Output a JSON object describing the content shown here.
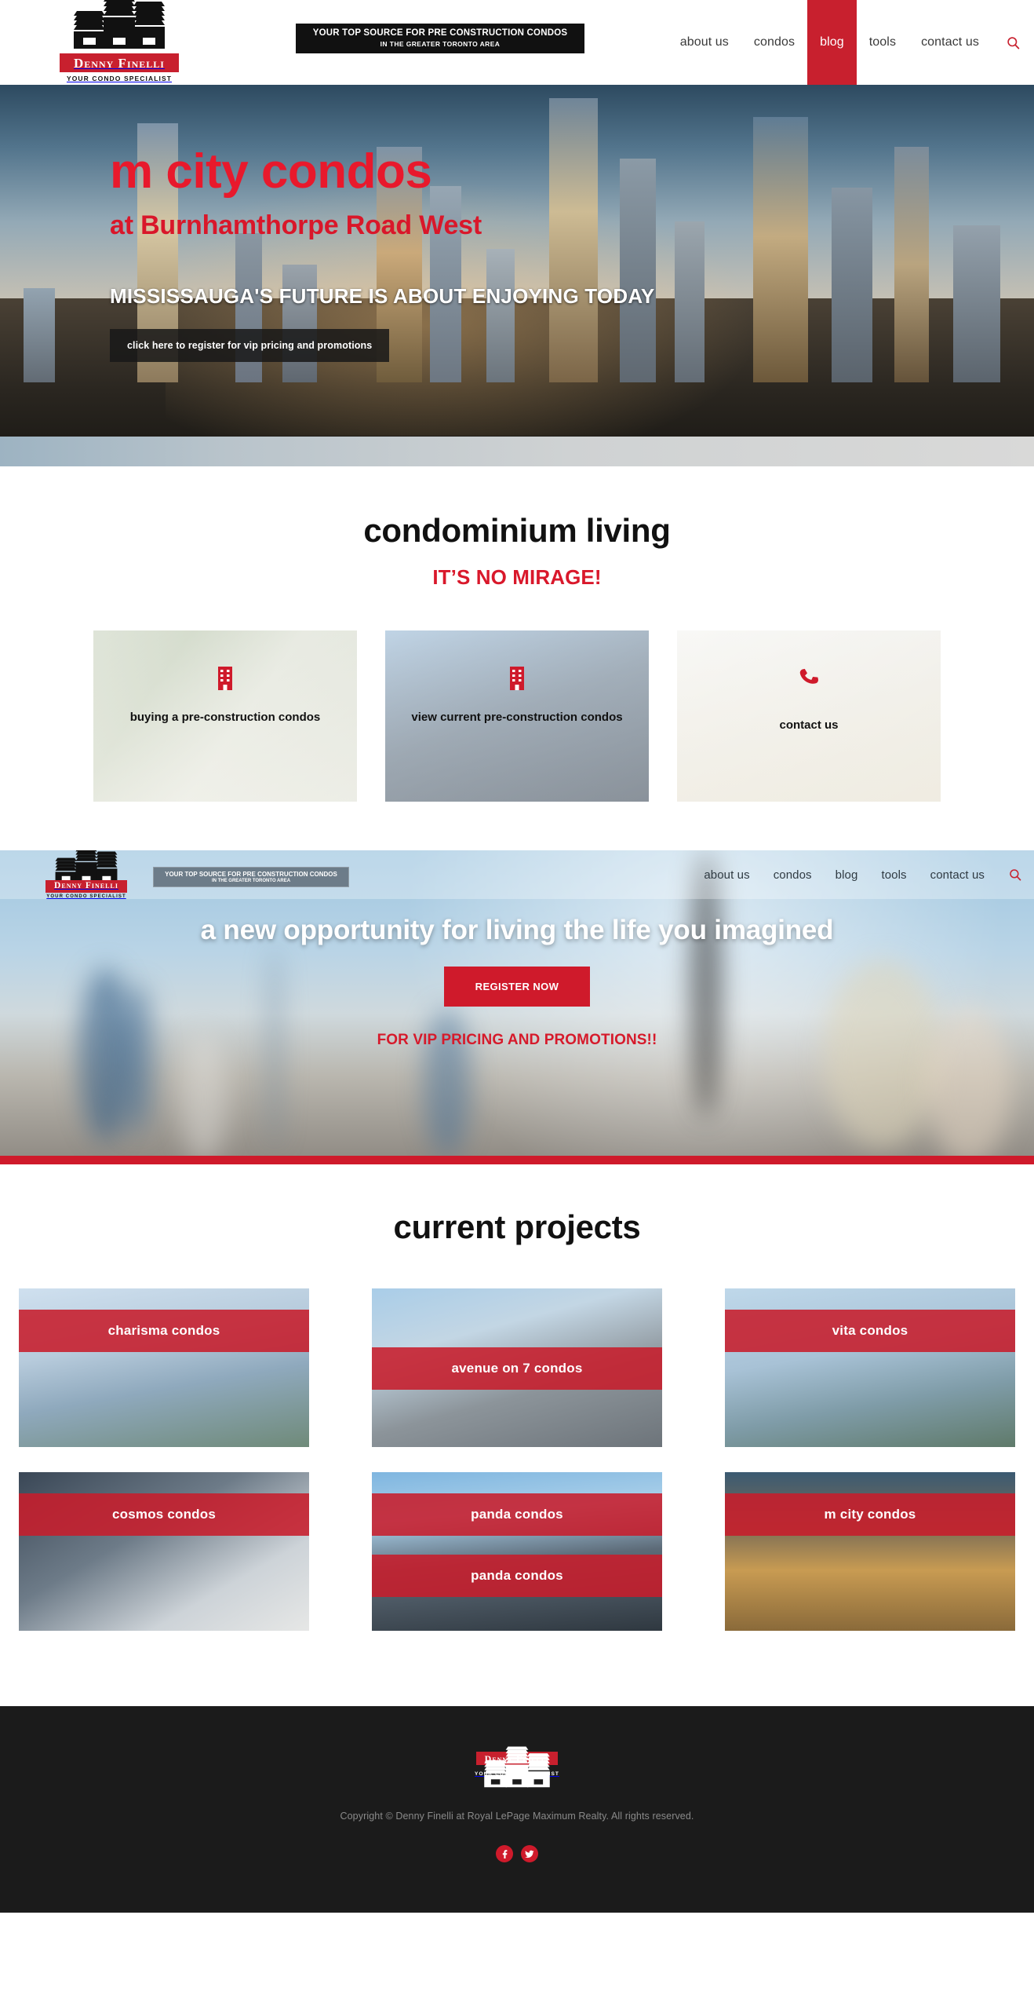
{
  "brand": {
    "name": "Denny Finelli",
    "tagline": "YOUR CONDO SPECIALIST",
    "accent_red": "#c8202e",
    "logo_icon": "buildings-skyline-icon"
  },
  "header": {
    "badge_line1": "YOUR TOP SOURCE FOR PRE CONSTRUCTION CONDOS",
    "badge_line2": "IN THE GREATER TORONTO AREA",
    "nav": [
      {
        "label": "about us",
        "active": false
      },
      {
        "label": "condos",
        "active": false
      },
      {
        "label": "blog",
        "active": true
      },
      {
        "label": "tools",
        "active": false
      },
      {
        "label": "contact us",
        "active": false
      }
    ],
    "search_icon": "search-icon"
  },
  "hero": {
    "title": "m city condos",
    "subtitle": "at Burnhamthorpe Road West",
    "kicker": "MISSISSAUGA'S FUTURE IS ABOUT ENJOYING TODAY",
    "button_label": "click here to register for vip pricing and promotions"
  },
  "living": {
    "title": "condominium living",
    "subtitle": "IT’S NO MIRAGE!",
    "cards": [
      {
        "label": "buying a pre-construction condos",
        "icon": "building-icon"
      },
      {
        "label": "view current pre-construction condos",
        "icon": "building-icon"
      },
      {
        "label": "contact us",
        "icon": "phone-icon"
      }
    ]
  },
  "cta": {
    "badge_line1": "YOUR TOP SOURCE FOR PRE CONSTRUCTION CONDOS",
    "badge_line2": "IN THE GREATER TORONTO AREA",
    "nav": [
      {
        "label": "about us"
      },
      {
        "label": "condos"
      },
      {
        "label": "blog"
      },
      {
        "label": "tools"
      },
      {
        "label": "contact us"
      }
    ],
    "title": "a new opportunity for living the life you imagined",
    "button_label": "REGISTER NOW",
    "note": "FOR VIP PRICING AND PROMOTIONS!!"
  },
  "projects": {
    "title": "current projects",
    "items": [
      {
        "label": "charisma condos",
        "bar": "bar-a"
      },
      {
        "label": "avenue on 7 condos",
        "bar": "bar-b"
      },
      {
        "label": "vita condos",
        "bar": "bar-a"
      },
      {
        "label": "cosmos condos",
        "bar": "bar-a"
      },
      {
        "label": "panda condos",
        "bar": "bar-a"
      },
      {
        "label": "m city condos",
        "bar": "bar-a"
      }
    ],
    "panda_duplicate_label": "panda condos"
  },
  "footer": {
    "copyright": "Copyright © Denny Finelli at Royal LePage Maximum Realty. All rights reserved.",
    "social": [
      {
        "name": "facebook-icon",
        "glyph": "f"
      },
      {
        "name": "twitter-icon",
        "glyph": "t"
      }
    ]
  }
}
